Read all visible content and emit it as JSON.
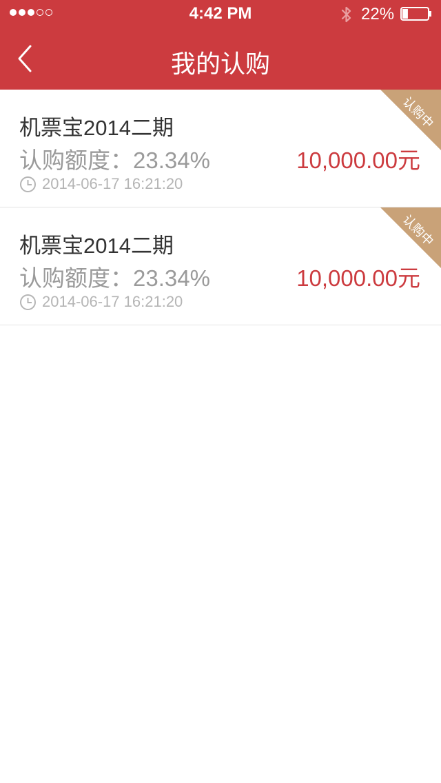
{
  "status_bar": {
    "time": "4:42 PM",
    "battery": "22%",
    "battery_level": 0.22,
    "signal_strength": 3,
    "signal_max": 5,
    "icons": [
      "signal-dots-icon",
      "bluetooth-icon",
      "battery-icon"
    ]
  },
  "nav": {
    "title": "我的认购",
    "back_icon": "chevron-left-icon"
  },
  "colors": {
    "brand_red": "#cc3b3f",
    "ribbon_tan": "#c9a278",
    "muted_gray": "#9a9a9a"
  },
  "subscriptions": [
    {
      "title": "机票宝2014二期",
      "quota": "认购额度：23.34%",
      "amount": "10,000.00元",
      "time": "2014-06-17 16:21:20",
      "status": "认购中"
    },
    {
      "title": "机票宝2014二期",
      "quota": "认购额度：23.34%",
      "amount": "10,000.00元",
      "time": "2014-06-17 16:21:20",
      "status": "认购中"
    }
  ]
}
